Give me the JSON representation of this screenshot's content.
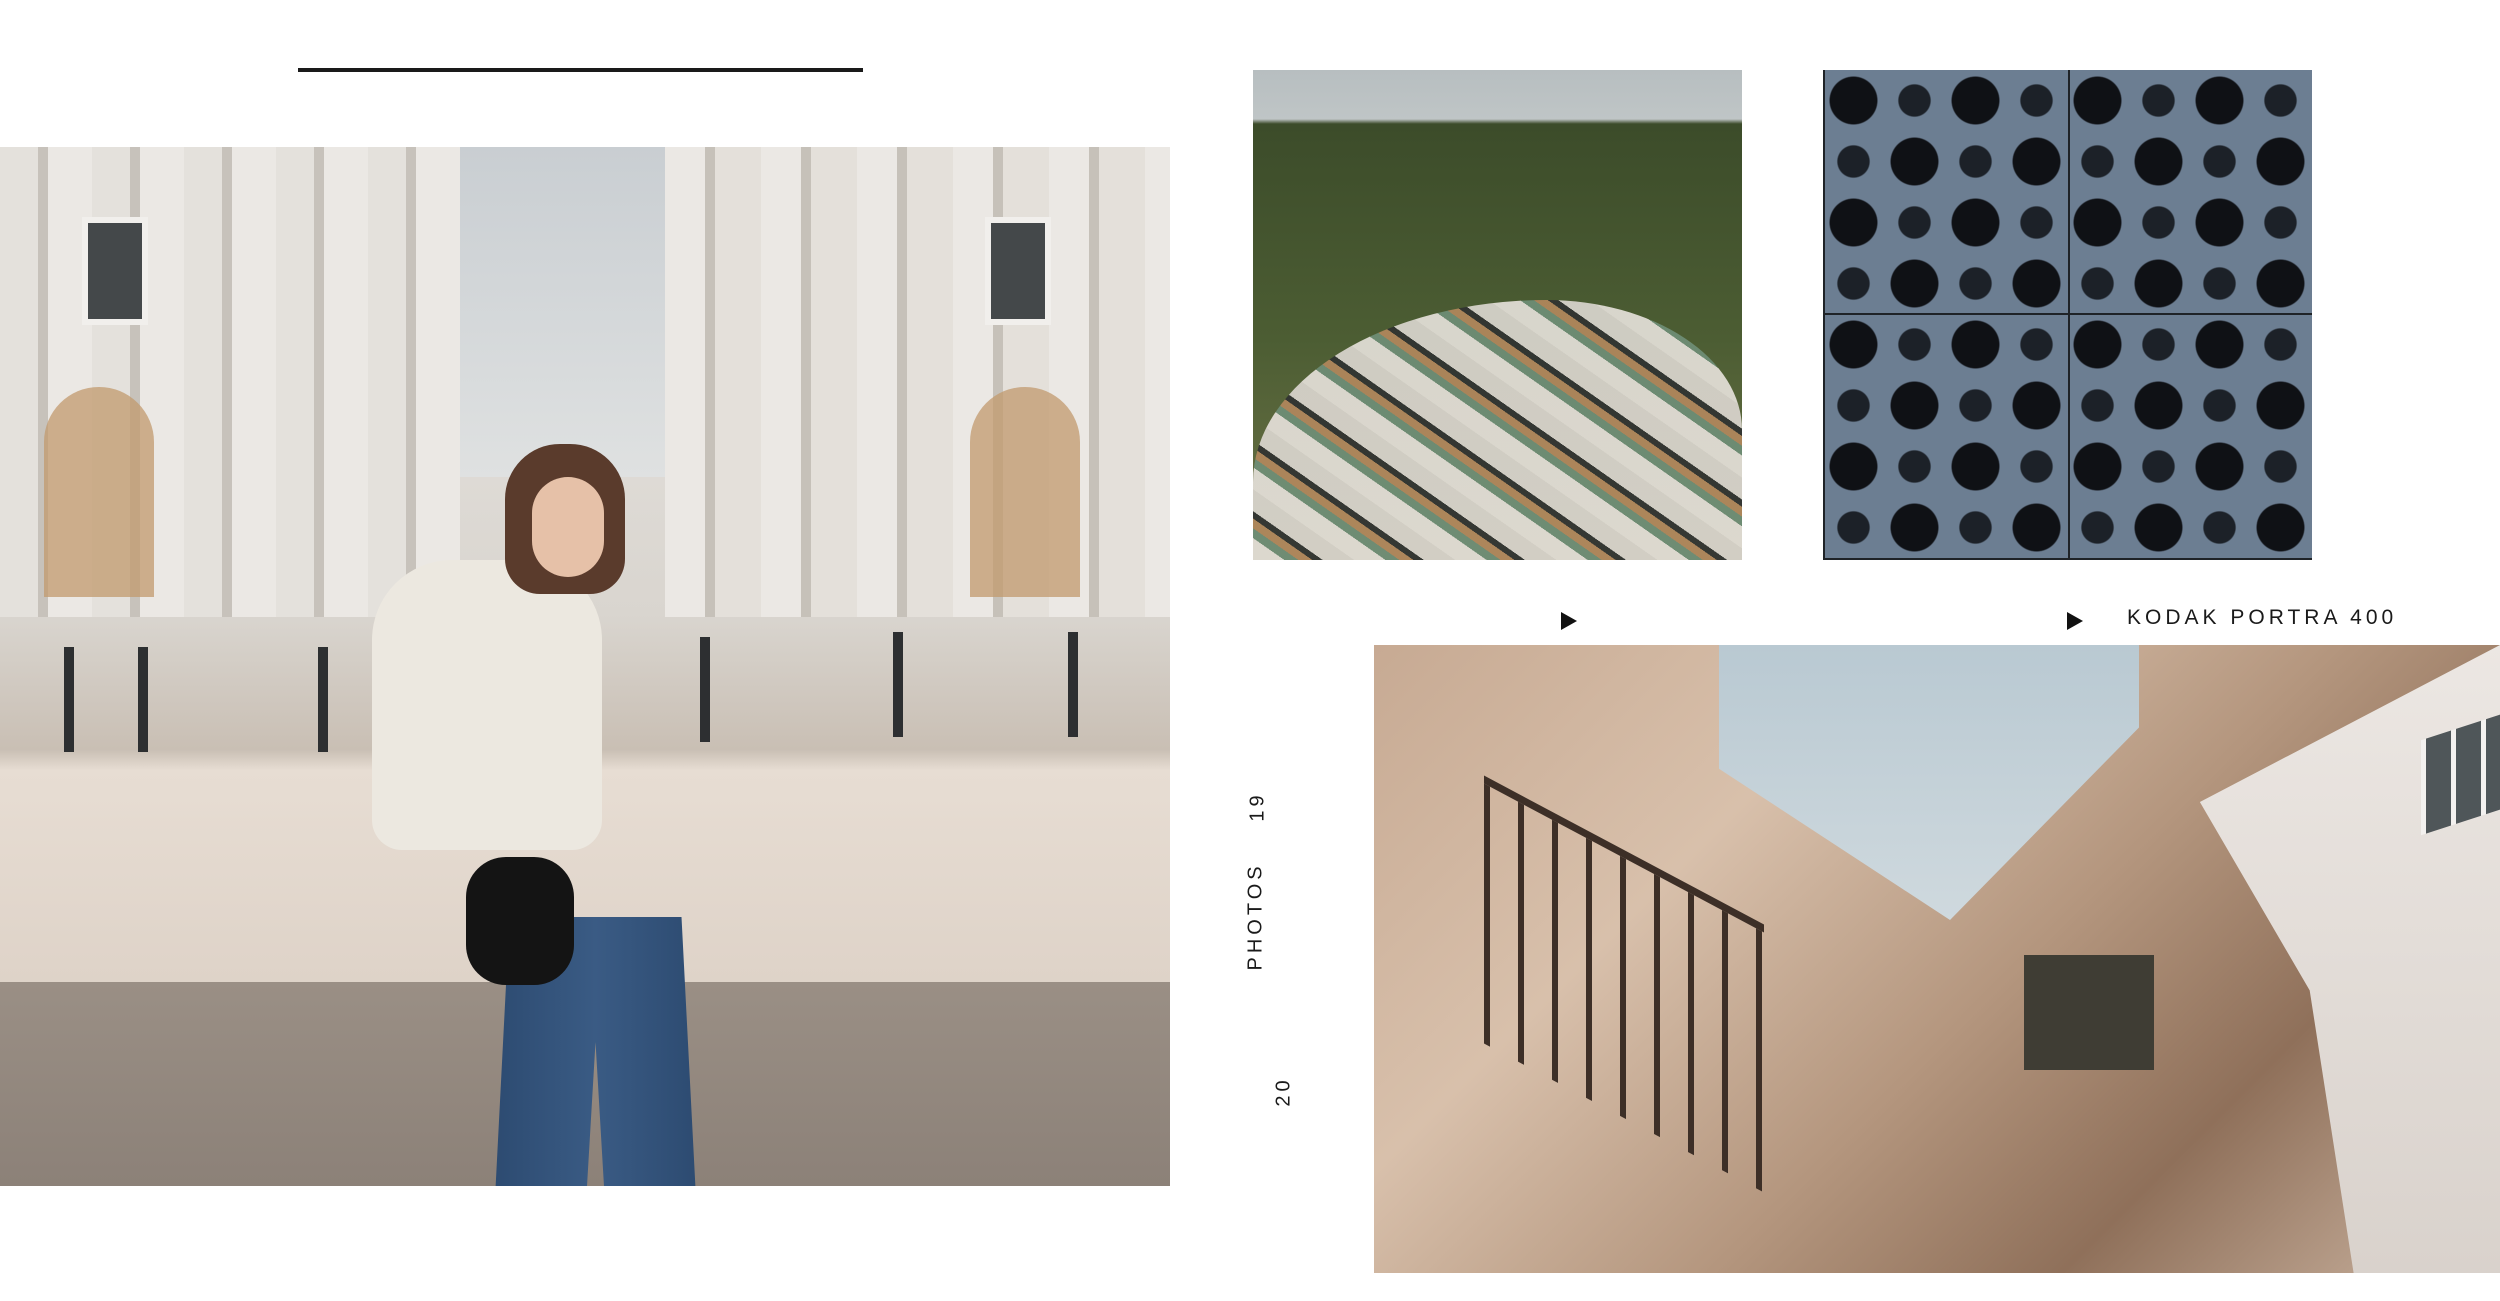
{
  "caption": {
    "film": "KODAK PORTRA 400",
    "vertical_label": "PHOTOS",
    "year_top": "19",
    "year_bottom": "20"
  },
  "icons": {
    "arrow_left": "play-triangle-icon",
    "arrow_right": "play-triangle-icon"
  },
  "colors": {
    "background": "#ffffff",
    "text": "#1a1a1a"
  }
}
